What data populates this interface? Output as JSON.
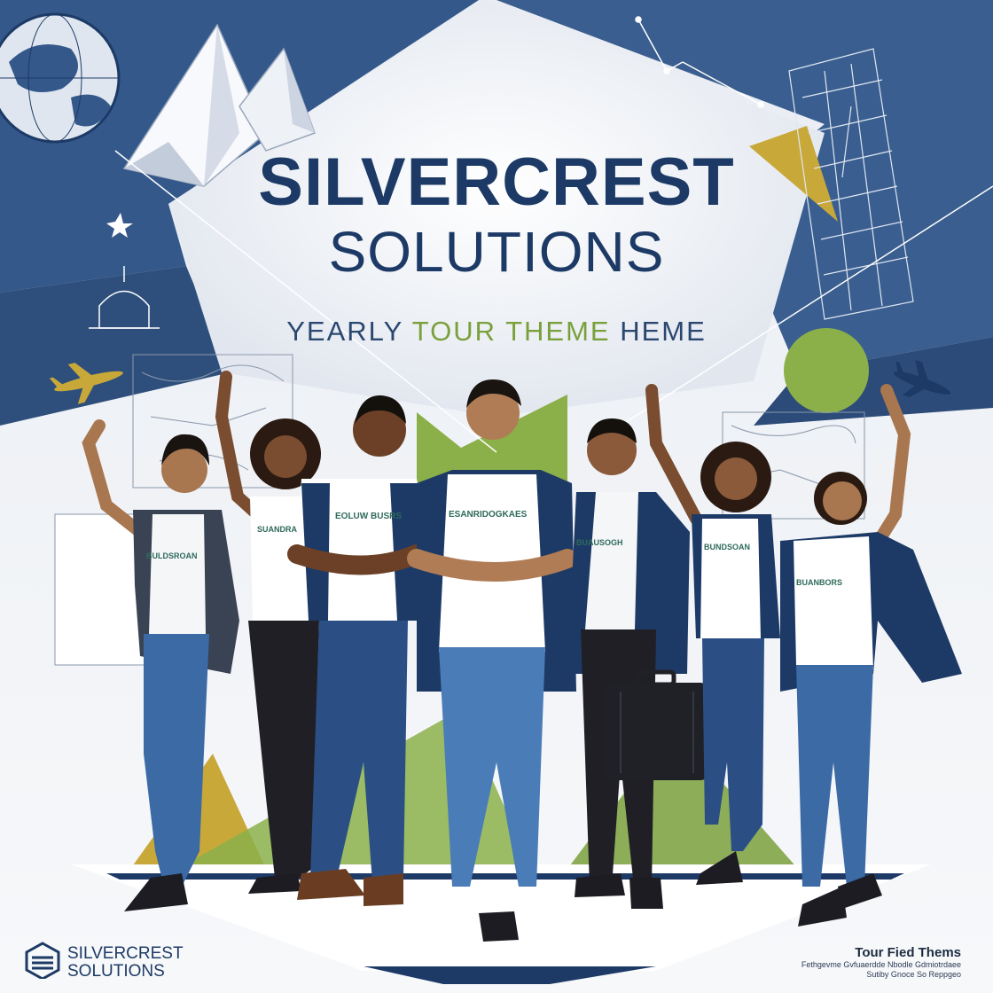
{
  "poster": {
    "title_line1": "SILVERCREST",
    "title_line2": "SOLUTIONS",
    "subtitle_part1": "YEARLY ",
    "subtitle_part2": "TOUR THEME",
    "subtitle_part3": " HEME",
    "logo_line1": "SILVERCREST",
    "logo_line2": "SOLUTIONS",
    "footer_title": "Tour Fied Thems",
    "footer_line1": "Fethgevme Gvfuaerdde Nbodle Gdmiotrdaee",
    "footer_line2": "Sutiby Gnoce So Reppgeo",
    "shirt_labels": [
      "BULDSROAN",
      "SUANDRA",
      "EOLUW BUSRS",
      "ESANRIDOGKAES",
      "BUAUSOGH",
      "BUNDSOAN",
      "BUANBORS"
    ]
  },
  "colors": {
    "navy": "#1d3a66",
    "blue_panel": "#34588a",
    "green": "#8bb04a",
    "gold": "#c9a83a",
    "light": "#f2f4f7"
  }
}
